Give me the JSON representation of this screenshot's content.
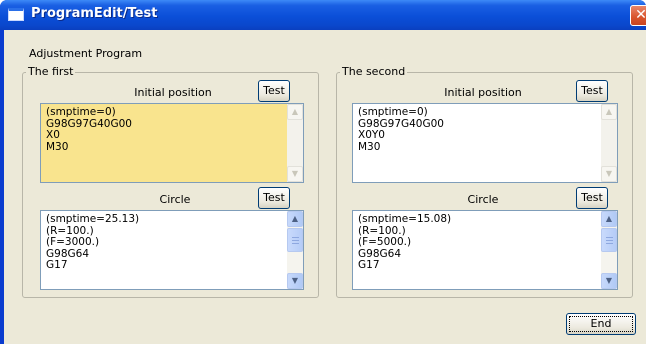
{
  "window": {
    "title": "ProgramEdit/Test",
    "close_glyph": "✕"
  },
  "heading": "Adjustment Program",
  "groups": [
    {
      "legend": "The first",
      "initial": {
        "label": "Initial position",
        "test_label": "Test",
        "text": [
          "(smptime=0)",
          "G98G97G40G00",
          "X0",
          "M30"
        ]
      },
      "circle": {
        "label": "Circle",
        "test_label": "Test",
        "text": [
          "(smptime=25.13)",
          "(R=100.)",
          "(F=3000.)",
          "G98G64",
          "G17"
        ]
      }
    },
    {
      "legend": "The second",
      "initial": {
        "label": "Initial position",
        "test_label": "Test",
        "text": [
          "(smptime=0)",
          "G98G97G40G00",
          "X0Y0",
          "M30"
        ]
      },
      "circle": {
        "label": "Circle",
        "test_label": "Test",
        "text": [
          "(smptime=15.08)",
          "(R=100.)",
          "(F=5000.)",
          "G98G64",
          "G17"
        ]
      }
    }
  ],
  "end_label": "End",
  "colors": {
    "title_bar": "#0b4fd8",
    "dialog_face": "#ece9d8",
    "highlight_textbox": "#f9e48e"
  }
}
